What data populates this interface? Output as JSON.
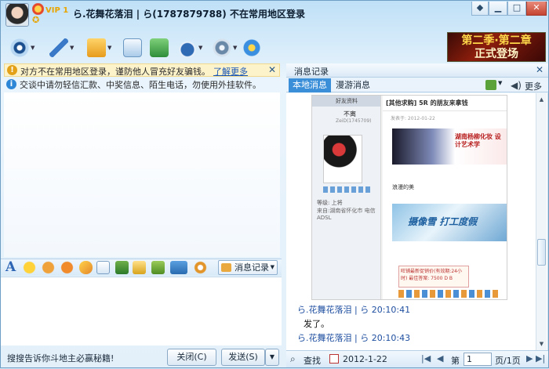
{
  "window": {
    "vip_label": "VIP 1",
    "title": "ら.花舞花落泪 | ら(1787879788) 不在常用地区登录",
    "controls": [
      "skin",
      "minimize",
      "maximize",
      "close"
    ]
  },
  "toolbar": {
    "tools": [
      "video-icon",
      "voice-icon",
      "file-transfer-icon",
      "mail-icon",
      "send-sms-icon",
      "app-icon",
      "settings-icon",
      "ie-icon"
    ]
  },
  "ad": {
    "line1": "第二季·第二章",
    "line2": "正式登场"
  },
  "notices": {
    "warning": "对方不在常用地区登录，谨防他人冒充好友骗钱。",
    "warning_link": "了解更多",
    "info": "交谈中请勿轻信汇款、中奖信息、陌生电话，勿使用外挂软件。"
  },
  "format_bar": {
    "history_button": "消息记录"
  },
  "bottom": {
    "promo": "搜搜告诉你斗地主必赢秘籍!",
    "close_button": "关闭(C)",
    "send_button": "发送(S)"
  },
  "history": {
    "title": "消息记录",
    "tabs": [
      "本地消息",
      "漫游消息"
    ],
    "more": "更多",
    "screenshot": {
      "header": "好友资料",
      "name": "不离",
      "status": "ZeiD(1745709)",
      "level": "等级: 上将",
      "from": "来自:湖南省怀化市 电信ADSL",
      "post_title": "[其他求购] 5R 的朋友来拿钱",
      "post_date": "发表于: 2012-01-22",
      "banner1": "湖南杨柳化妆 设计艺术学",
      "note": "浪漫的美",
      "banner2": "摄像雪 打工度假",
      "shop": "旺铺最新促销价(有效期:24小时) 最佳答案: 7500 D B"
    },
    "messages": [
      {
        "sender": "ら.花舞花落泪 | ら 20:10:41",
        "text": "发了。"
      },
      {
        "sender": "ら.花舞花落泪 | ら 20:10:43",
        "text": ""
      }
    ],
    "footer": {
      "search": "查找",
      "date": "2012-1-22",
      "page_prefix": "第",
      "page_value": "1",
      "page_total": "页/1页"
    }
  },
  "colors": {
    "accent": "#3b8fd8",
    "close_red": "#c44531",
    "ad_gold": "#ffd84a"
  }
}
